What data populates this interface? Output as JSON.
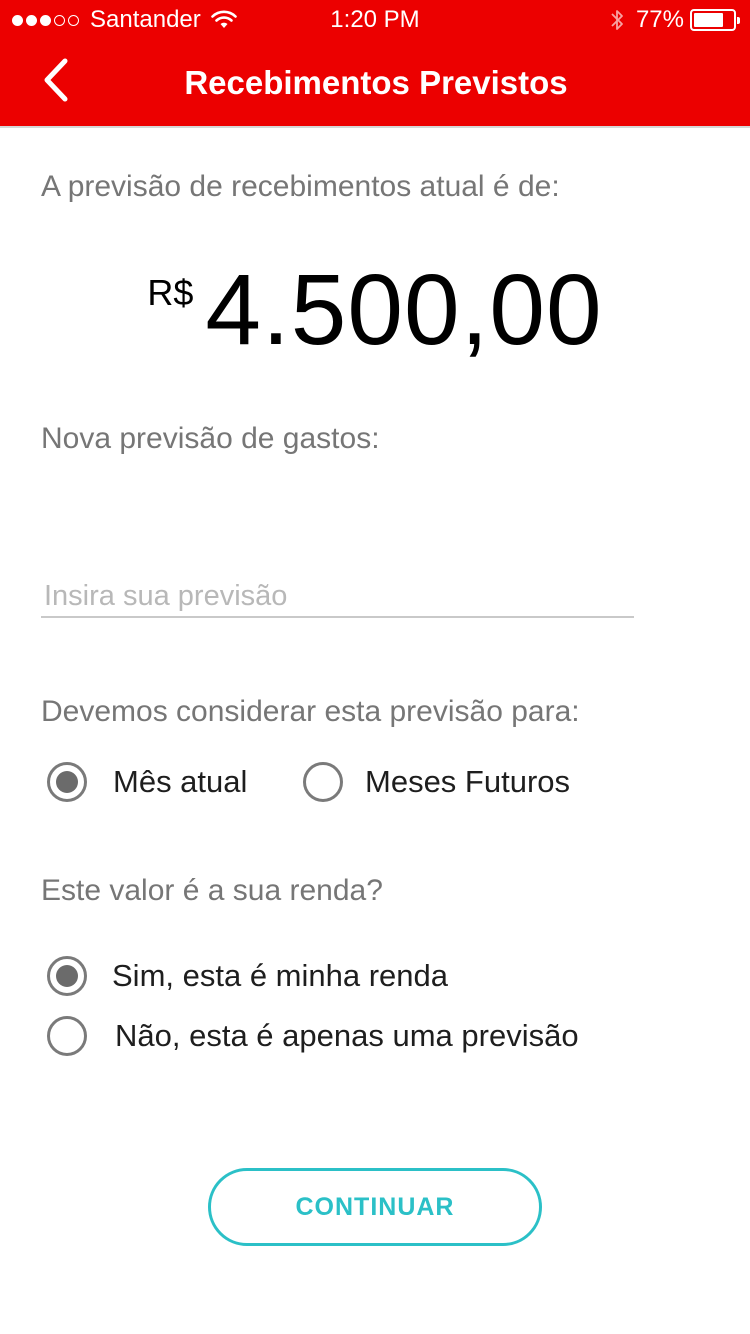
{
  "status_bar": {
    "carrier": "Santander",
    "time": "1:20 PM",
    "battery_percent": "77%",
    "battery_level": 0.77,
    "signal_bars_filled": 3,
    "signal_bars_total": 5,
    "icons": [
      "wifi-icon",
      "bluetooth-icon",
      "battery-icon"
    ]
  },
  "nav": {
    "title": "Recebimentos Previstos",
    "back_icon": "chevron-left-icon"
  },
  "current_forecast": {
    "label": "A previsão de recebimentos atual é de:",
    "currency": "R$",
    "amount": "4.500,00"
  },
  "new_forecast": {
    "label": "Nova previsão de gastos:",
    "placeholder": "Insira sua previsão",
    "value": ""
  },
  "period_question": {
    "label": "Devemos considerar esta previsão para:",
    "options": [
      {
        "label": "Mês atual",
        "selected": true
      },
      {
        "label": "Meses Futuros",
        "selected": false
      }
    ]
  },
  "income_question": {
    "label": "Este valor é a sua renda?",
    "options": [
      {
        "label": "Sim, esta é minha renda",
        "selected": true
      },
      {
        "label": "Não, esta é apenas uma previsão",
        "selected": false
      }
    ]
  },
  "actions": {
    "continue_label": "CONTINUAR"
  },
  "colors": {
    "brand_red": "#ec0000",
    "accent_teal": "#2bc0c7",
    "label_gray": "#767676",
    "placeholder_gray": "#b8b8b8"
  }
}
